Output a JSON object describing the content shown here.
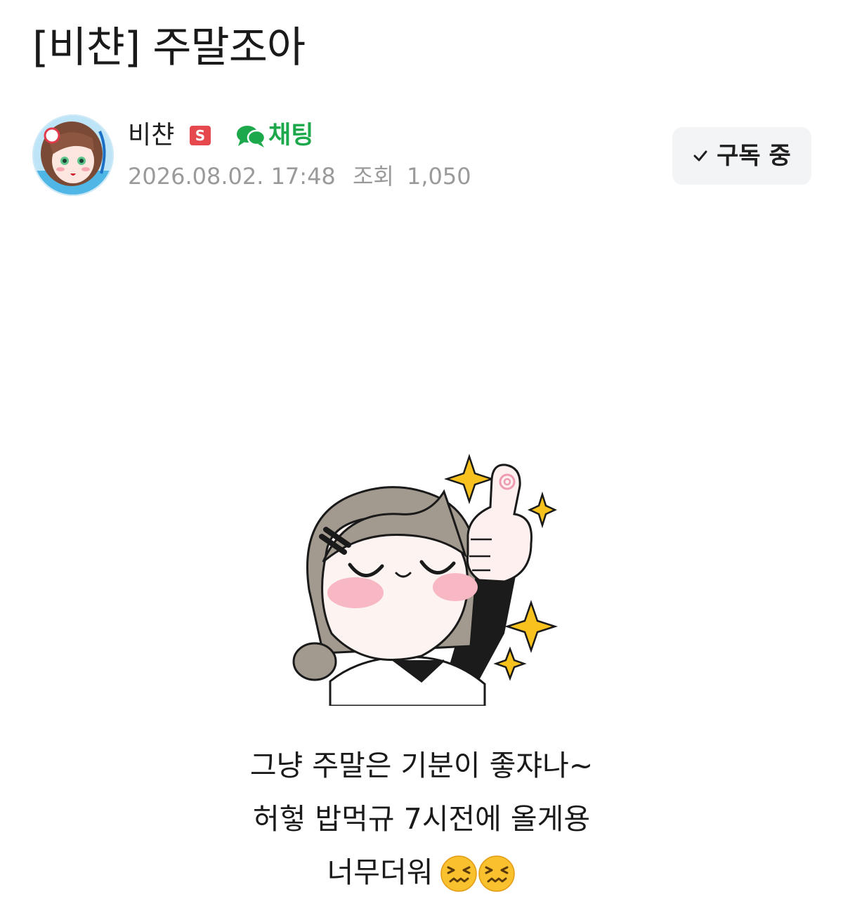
{
  "post": {
    "title": "[비챤] 주말조아",
    "body_lines": [
      "그냥 주말은 기분이 좋쟈나~",
      "허헣 밥먹규 7시전에 올게용",
      "너무더워"
    ],
    "emoji": [
      "confounded-face",
      "confounded-face"
    ]
  },
  "author": {
    "name": "비챤",
    "badge": "S",
    "chat_label": "채팅",
    "avatar": "author-avatar"
  },
  "meta": {
    "datetime": "2026.08.02. 17:48",
    "views_label": "조회",
    "views": "1,050"
  },
  "subscribe": {
    "label": "구독 중",
    "icon": "check-icon"
  },
  "colors": {
    "chat_green": "#1ca84b",
    "badge_red": "#e5484d",
    "meta_gray": "#9a9a9a",
    "button_bg": "#f3f4f6"
  }
}
